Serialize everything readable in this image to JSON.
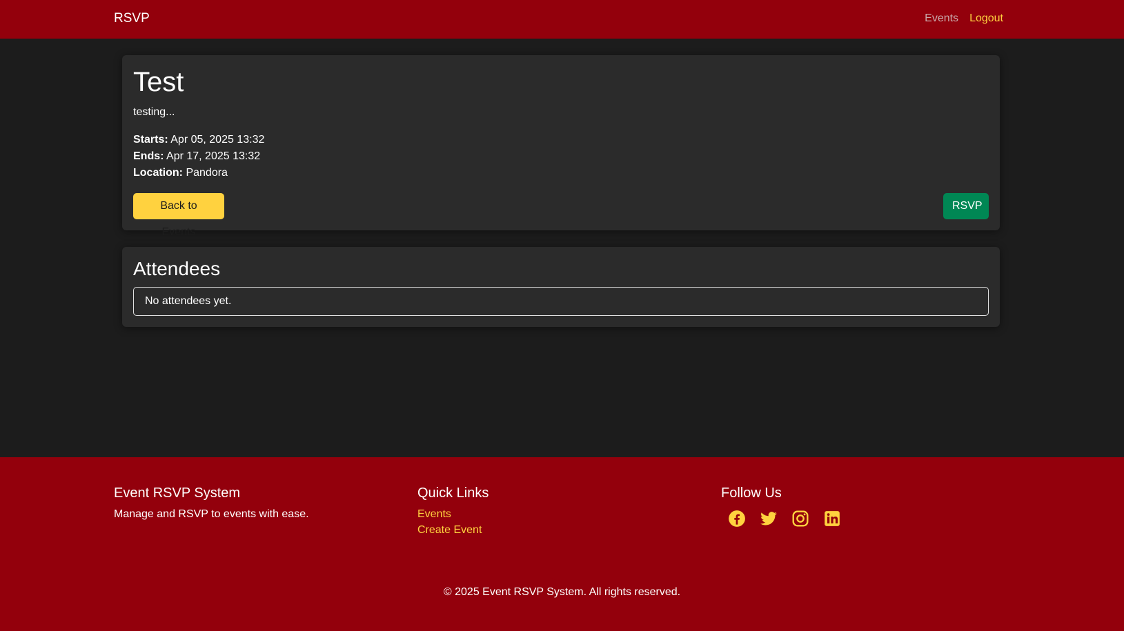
{
  "navbar": {
    "brand": "RSVP",
    "links": [
      {
        "label": "Events"
      },
      {
        "label": "Logout"
      }
    ]
  },
  "event": {
    "title": "Test",
    "description": "testing...",
    "starts_label": "Starts:",
    "starts_value": "Apr 05, 2025 13:32",
    "ends_label": "Ends:",
    "ends_value": "Apr 17, 2025 13:32",
    "location_label": "Location:",
    "location_value": "Pandora",
    "back_button": "Back to Events",
    "rsvp_button": "RSVP"
  },
  "attendees": {
    "title": "Attendees",
    "empty_text": "No attendees yet."
  },
  "footer": {
    "about_heading": "Event RSVP System",
    "about_text": "Manage and RSVP to events with ease.",
    "links_heading": "Quick Links",
    "links": [
      {
        "label": "Events"
      },
      {
        "label": "Create Event"
      }
    ],
    "follow_heading": "Follow Us",
    "socials": [
      "facebook-icon",
      "twitter-icon",
      "instagram-icon",
      "linkedin-icon"
    ],
    "copyright": "© 2025 Event RSVP System. All rights reserved."
  },
  "colors": {
    "brand_red": "#93000c",
    "accent_yellow": "#ffd23f",
    "success_green": "#008754",
    "background": "#1c1c1c",
    "card": "#2b2b2b"
  }
}
